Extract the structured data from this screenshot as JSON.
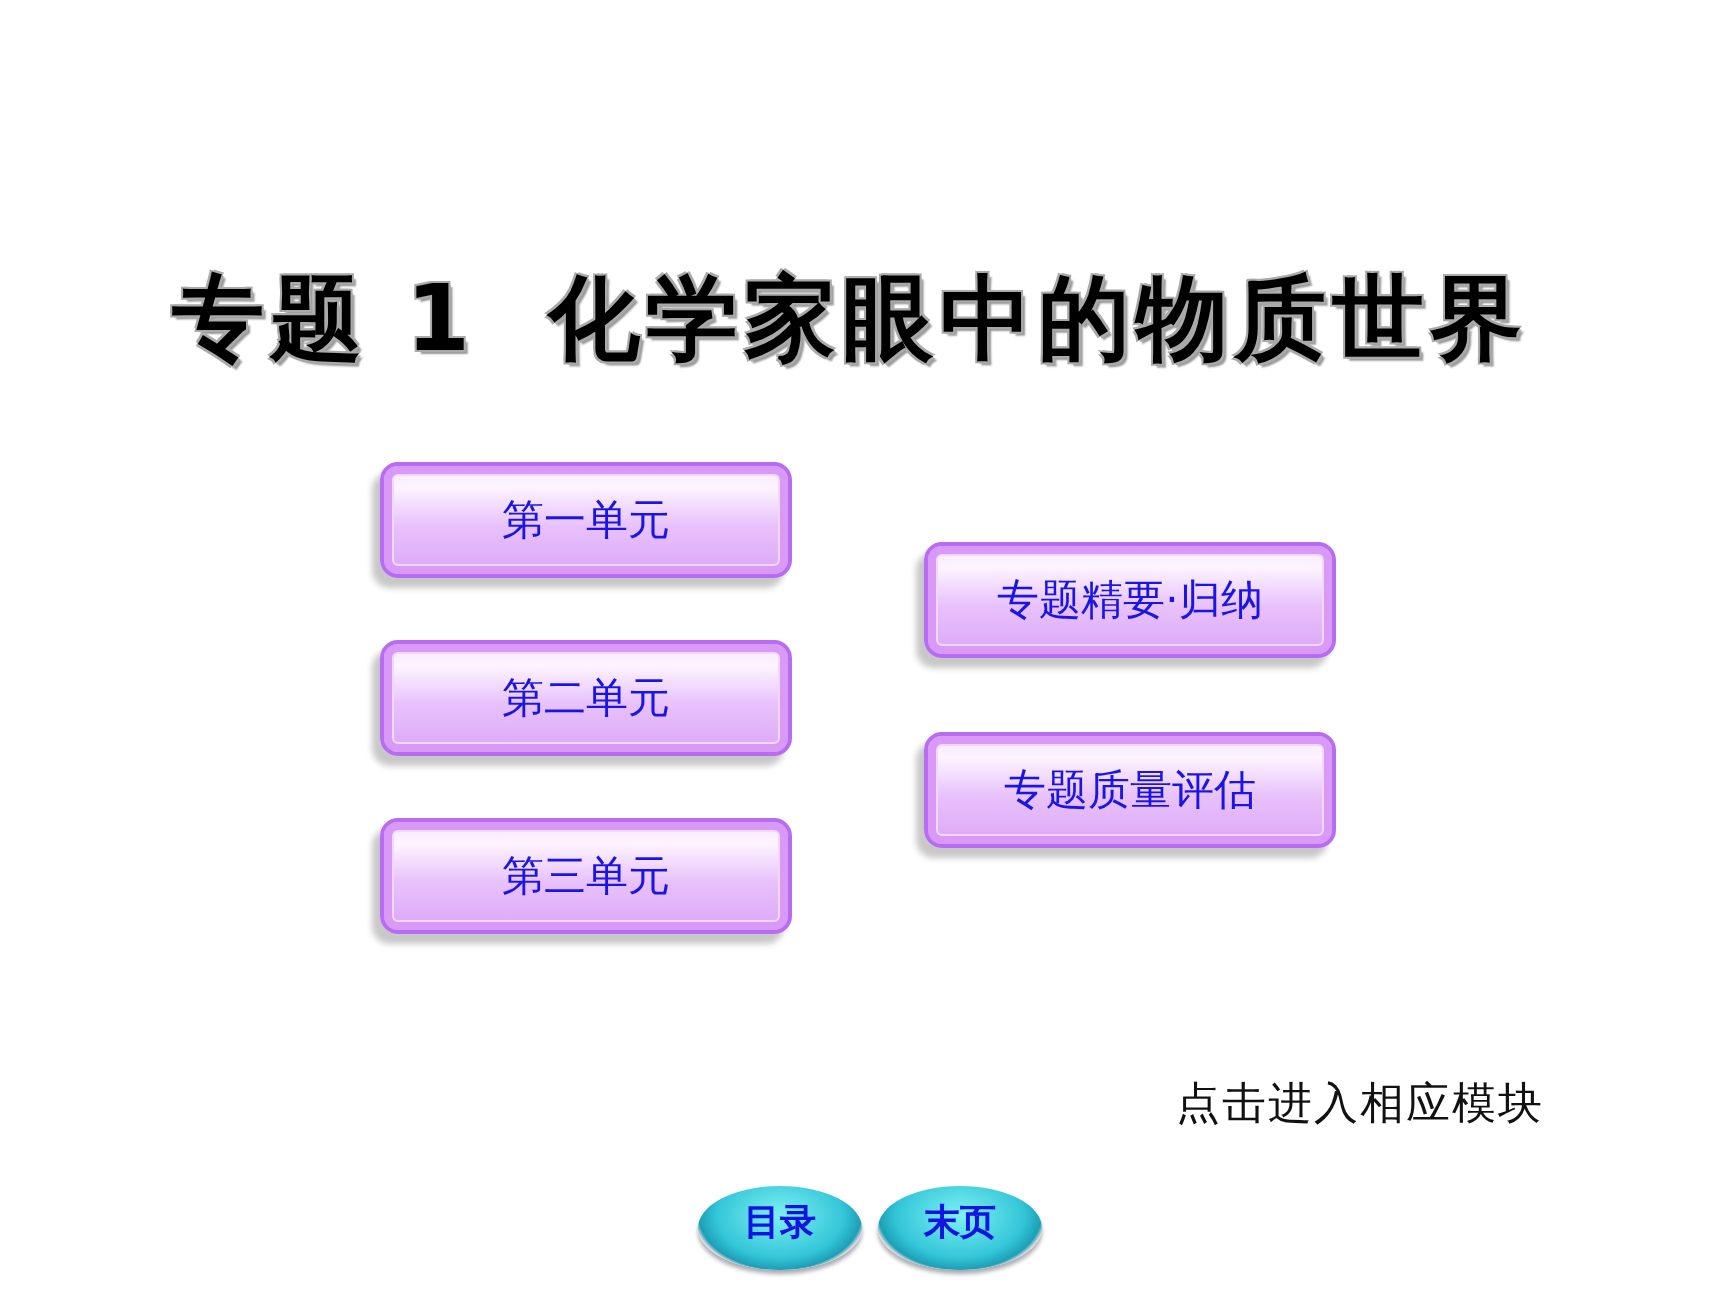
{
  "title": {
    "number_label": "专题 1",
    "text": "化学家眼中的物质世界"
  },
  "units": [
    {
      "label": "第一单元"
    },
    {
      "label": "第二单元"
    },
    {
      "label": "第三单元"
    }
  ],
  "topic_links": [
    {
      "label": "专题精要·归纳"
    },
    {
      "label": "专题质量评估"
    }
  ],
  "hint": "点击进入相应模块",
  "nav_buttons": [
    {
      "label": "目录"
    },
    {
      "label": "末页"
    }
  ]
}
